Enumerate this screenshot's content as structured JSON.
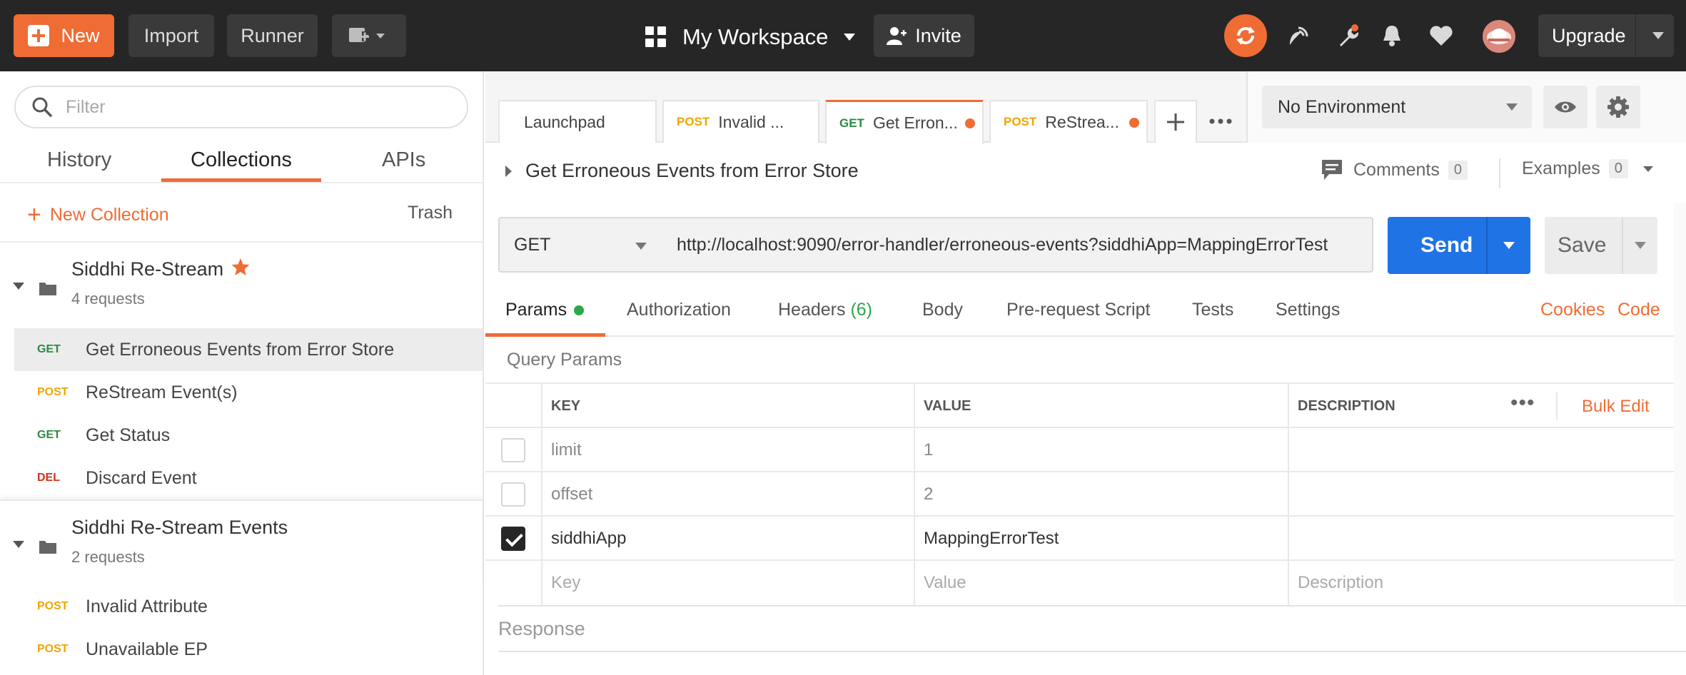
{
  "topbar": {
    "new_label": "New",
    "import_label": "Import",
    "runner_label": "Runner",
    "workspace_label": "My Workspace",
    "invite_label": "Invite",
    "upgrade_label": "Upgrade",
    "accent_color": "#ef6c35"
  },
  "sidebar": {
    "filter_placeholder": "Filter",
    "tabs": [
      {
        "label": "History"
      },
      {
        "label": "Collections"
      },
      {
        "label": "APIs"
      }
    ],
    "new_collection_label": "New Collection",
    "trash_label": "Trash",
    "collections": [
      {
        "name": "Siddhi Re-Stream",
        "count": "4 requests",
        "starred": true,
        "requests": [
          {
            "method": "GET",
            "name": "Get Erroneous Events from Error Store"
          },
          {
            "method": "POST",
            "name": "ReStream Event(s)"
          },
          {
            "method": "GET",
            "name": "Get Status"
          },
          {
            "method": "DEL",
            "name": "Discard Event"
          }
        ]
      },
      {
        "name": "Siddhi Re-Stream Events",
        "count": "2 requests",
        "requests": [
          {
            "method": "POST",
            "name": "Invalid Attribute"
          },
          {
            "method": "POST",
            "name": "Unavailable EP"
          }
        ]
      }
    ]
  },
  "tabs": [
    {
      "method": "",
      "label": "Launchpad"
    },
    {
      "method": "POST",
      "label": "Invalid ..."
    },
    {
      "method": "GET",
      "label": "Get Erron..."
    },
    {
      "method": "POST",
      "label": "ReStrea..."
    }
  ],
  "environment": {
    "selected": "No Environment"
  },
  "request": {
    "title": "Get Erroneous Events from Error Store",
    "comments_label": "Comments",
    "comments_count": "0",
    "examples_label": "Examples",
    "examples_count": "0",
    "method": "GET",
    "url": "http://localhost:9090/error-handler/erroneous-events?siddhiApp=MappingErrorTest",
    "send_label": "Send",
    "save_label": "Save"
  },
  "subtabs": {
    "params": "Params",
    "authorization": "Authorization",
    "headers": "Headers",
    "headers_count": "(6)",
    "body": "Body",
    "pre_request": "Pre-request Script",
    "tests": "Tests",
    "settings": "Settings",
    "cookies": "Cookies",
    "code": "Code"
  },
  "query_params": {
    "label": "Query Params",
    "headers": {
      "key": "KEY",
      "value": "VALUE",
      "description": "DESCRIPTION"
    },
    "bulk_edit": "Bulk Edit",
    "rows": [
      {
        "checked": false,
        "key": "limit",
        "value": "1",
        "description": ""
      },
      {
        "checked": false,
        "key": "offset",
        "value": "2",
        "description": ""
      },
      {
        "checked": true,
        "key": "siddhiApp",
        "value": "MappingErrorTest",
        "description": ""
      }
    ],
    "placeholder": {
      "key": "Key",
      "value": "Value",
      "description": "Description"
    }
  },
  "response": {
    "label": "Response"
  }
}
